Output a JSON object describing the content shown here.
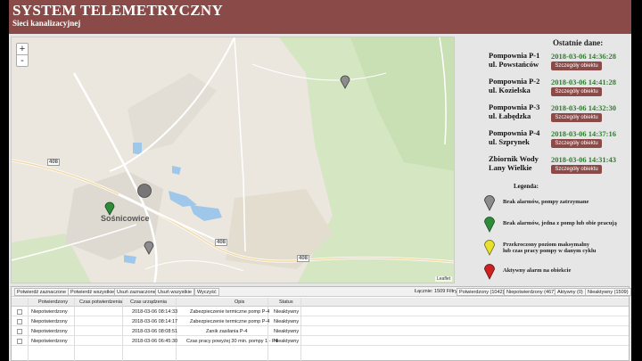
{
  "header": {
    "title": "SYSTEM TELEMETRYCZNY",
    "subtitle": "Sieci kanalizacyjnej"
  },
  "map": {
    "zoom_in": "+",
    "zoom_out": "-",
    "attribution": "Leaflet",
    "town_label": "Sośnicowice",
    "road_numbers": [
      "408",
      "408",
      "408"
    ],
    "marker_colors": {
      "gray": "#8c8c8c",
      "green": "#2e8b3a"
    }
  },
  "panel": {
    "title": "Ostatnie dane:",
    "button_label": "Szczegóły obiektu",
    "stations": [
      {
        "name1": "Pompownia P-1",
        "name2": "ul. Powstańców",
        "time": "2018-03-06 14:36:28"
      },
      {
        "name1": "Pompownia P-2",
        "name2": "ul. Kozielska",
        "time": "2018-03-06 14:41:28"
      },
      {
        "name1": "Pompownia P-3",
        "name2": "ul. Łabędzka",
        "time": "2018-03-06 14:32:30"
      },
      {
        "name1": "Pompownia P-4",
        "name2": "ul. Szprynek",
        "time": "2018-03-06 14:37:16"
      },
      {
        "name1": "Zbiornik Wody",
        "name2": "Lany Wielkie",
        "time": "2018-03-06 14:31:43"
      }
    ],
    "legend_title": "Legenda:",
    "legend": [
      {
        "color": "#8c8c8c",
        "line1": "Brak alarmów, pompy zatrzymane",
        "line2": ""
      },
      {
        "color": "#2e8b3a",
        "line1": "Brak alarmów, jedna z pomp lub obie pracują",
        "line2": ""
      },
      {
        "color": "#e8e02a",
        "line1": "Przekroczony poziom maksymalny",
        "line2": "lub czas pracy pompy w danym cyklu"
      },
      {
        "color": "#cc2222",
        "line1": "Aktywny alarm na obiekcie",
        "line2": ""
      }
    ]
  },
  "grid": {
    "toolbar": {
      "confirm_selected": "Potwierdź zaznaczone",
      "confirm_all": "Potwierdź wszystkie",
      "delete_selected": "Usuń zaznaczone",
      "delete_all": "Usuń wszystkie",
      "clear": "Wyczyść",
      "total": "Łącznie: 1509 Filtry:",
      "filter_confirmed": "Potwierdzony (1042)",
      "filter_unconfirmed": "Niepotwierdzony (467)",
      "filter_active": "Aktywny (0)",
      "filter_inactive": "Nieaktywny (1509)"
    },
    "columns": [
      "Potwierdzony",
      "Czas potwierdzenia",
      "Czas urządzenia",
      "Opis",
      "Status"
    ],
    "rows": [
      {
        "confirmed": "Niepotwierdzony",
        "confirm_time": "",
        "device_time": "2018-03-06 08:14:33",
        "desc": "Zabezpieczenie termiczne pomp P-4",
        "status": "Nieaktywny"
      },
      {
        "confirmed": "Niepotwierdzony",
        "confirm_time": "",
        "device_time": "2018-03-06 08:14:17",
        "desc": "Zabezpieczenie termiczne pomp P-4",
        "status": "Nieaktywny"
      },
      {
        "confirmed": "Niepotwierdzony",
        "confirm_time": "",
        "device_time": "2018-03-06 08:08:51",
        "desc": "Zanik zasilania P-4",
        "status": "Nieaktywny"
      },
      {
        "confirmed": "Niepotwierdzony",
        "confirm_time": "",
        "device_time": "2018-03-06 06:45:30",
        "desc": "Czas pracy powyżej 30 min. pompy 1 - P4",
        "status": "Nieaktywny"
      }
    ]
  }
}
